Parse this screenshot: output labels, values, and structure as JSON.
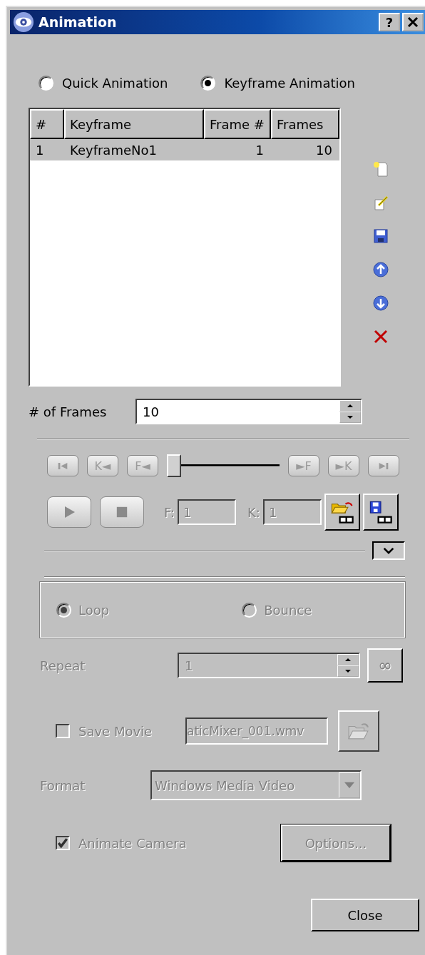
{
  "window": {
    "title": "Animation",
    "help": "?"
  },
  "mode_options": [
    {
      "label": "Quick Animation",
      "selected": false
    },
    {
      "label": "Keyframe Animation",
      "selected": true
    }
  ],
  "keyframe_table": {
    "columns": [
      "#",
      "Keyframe",
      "Frame #",
      "Frames"
    ],
    "rows": [
      {
        "cells": [
          "1",
          "KeyframeNo1",
          "1",
          "10"
        ],
        "selected": true
      }
    ]
  },
  "frames": {
    "label": "# of Frames",
    "value": "10"
  },
  "transport": {
    "disabled": true,
    "buttons": [
      {
        "kind": "first"
      },
      {
        "kind": "text",
        "label": "K◄"
      },
      {
        "kind": "text",
        "label": "F◄"
      }
    ],
    "buttons_right": [
      {
        "kind": "text",
        "label": "►F"
      },
      {
        "kind": "text",
        "label": "►K"
      },
      {
        "kind": "last"
      }
    ],
    "slider": {
      "level": 0
    },
    "frame_field": {
      "label": "F:",
      "value": "1"
    },
    "key_field": {
      "label": "K:",
      "value": "1"
    }
  },
  "settings": {
    "disabled": true,
    "playback_modes": [
      {
        "label": "Loop",
        "selected": true
      },
      {
        "label": "Bounce",
        "selected": false
      }
    ],
    "repeat": {
      "label": "Repeat",
      "value": "1",
      "infinite": "∞"
    },
    "save_movie": {
      "label": "Save Movie",
      "checked": false,
      "value": "aticMixer_001.wmv"
    },
    "format": {
      "label": "Format",
      "value": "Windows Media Video"
    },
    "animate_camera": {
      "label": "Animate Camera",
      "checked": true
    },
    "options": "Options..."
  },
  "close": "Close"
}
